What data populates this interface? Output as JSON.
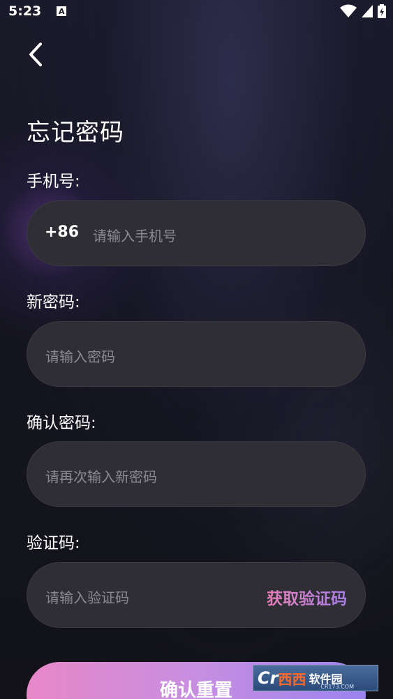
{
  "status_bar": {
    "time": "5:23",
    "notification_badge": "A"
  },
  "title": "忘记密码",
  "phone": {
    "label": "手机号:",
    "prefix": "+86",
    "placeholder": "请输入手机号"
  },
  "new_password": {
    "label": "新密码:",
    "placeholder": "请输入密码"
  },
  "confirm_password": {
    "label": "确认密码:",
    "placeholder": "请再次输入新密码"
  },
  "verification": {
    "label": "验证码:",
    "placeholder": "请输入验证码",
    "get_code_label": "获取验证码"
  },
  "submit_label": "确认重置",
  "watermark": {
    "logo": "Cr",
    "brand": "西西",
    "text": "软件园",
    "site": "CR173.COM"
  },
  "colors": {
    "accent_start": "#e888c8",
    "accent_end": "#9b83ef",
    "field_bg": "#2f2e35",
    "placeholder": "#8b8a94"
  },
  "icons": [
    "back-arrow-icon",
    "wifi-icon",
    "signal-icon",
    "battery-icon"
  ]
}
